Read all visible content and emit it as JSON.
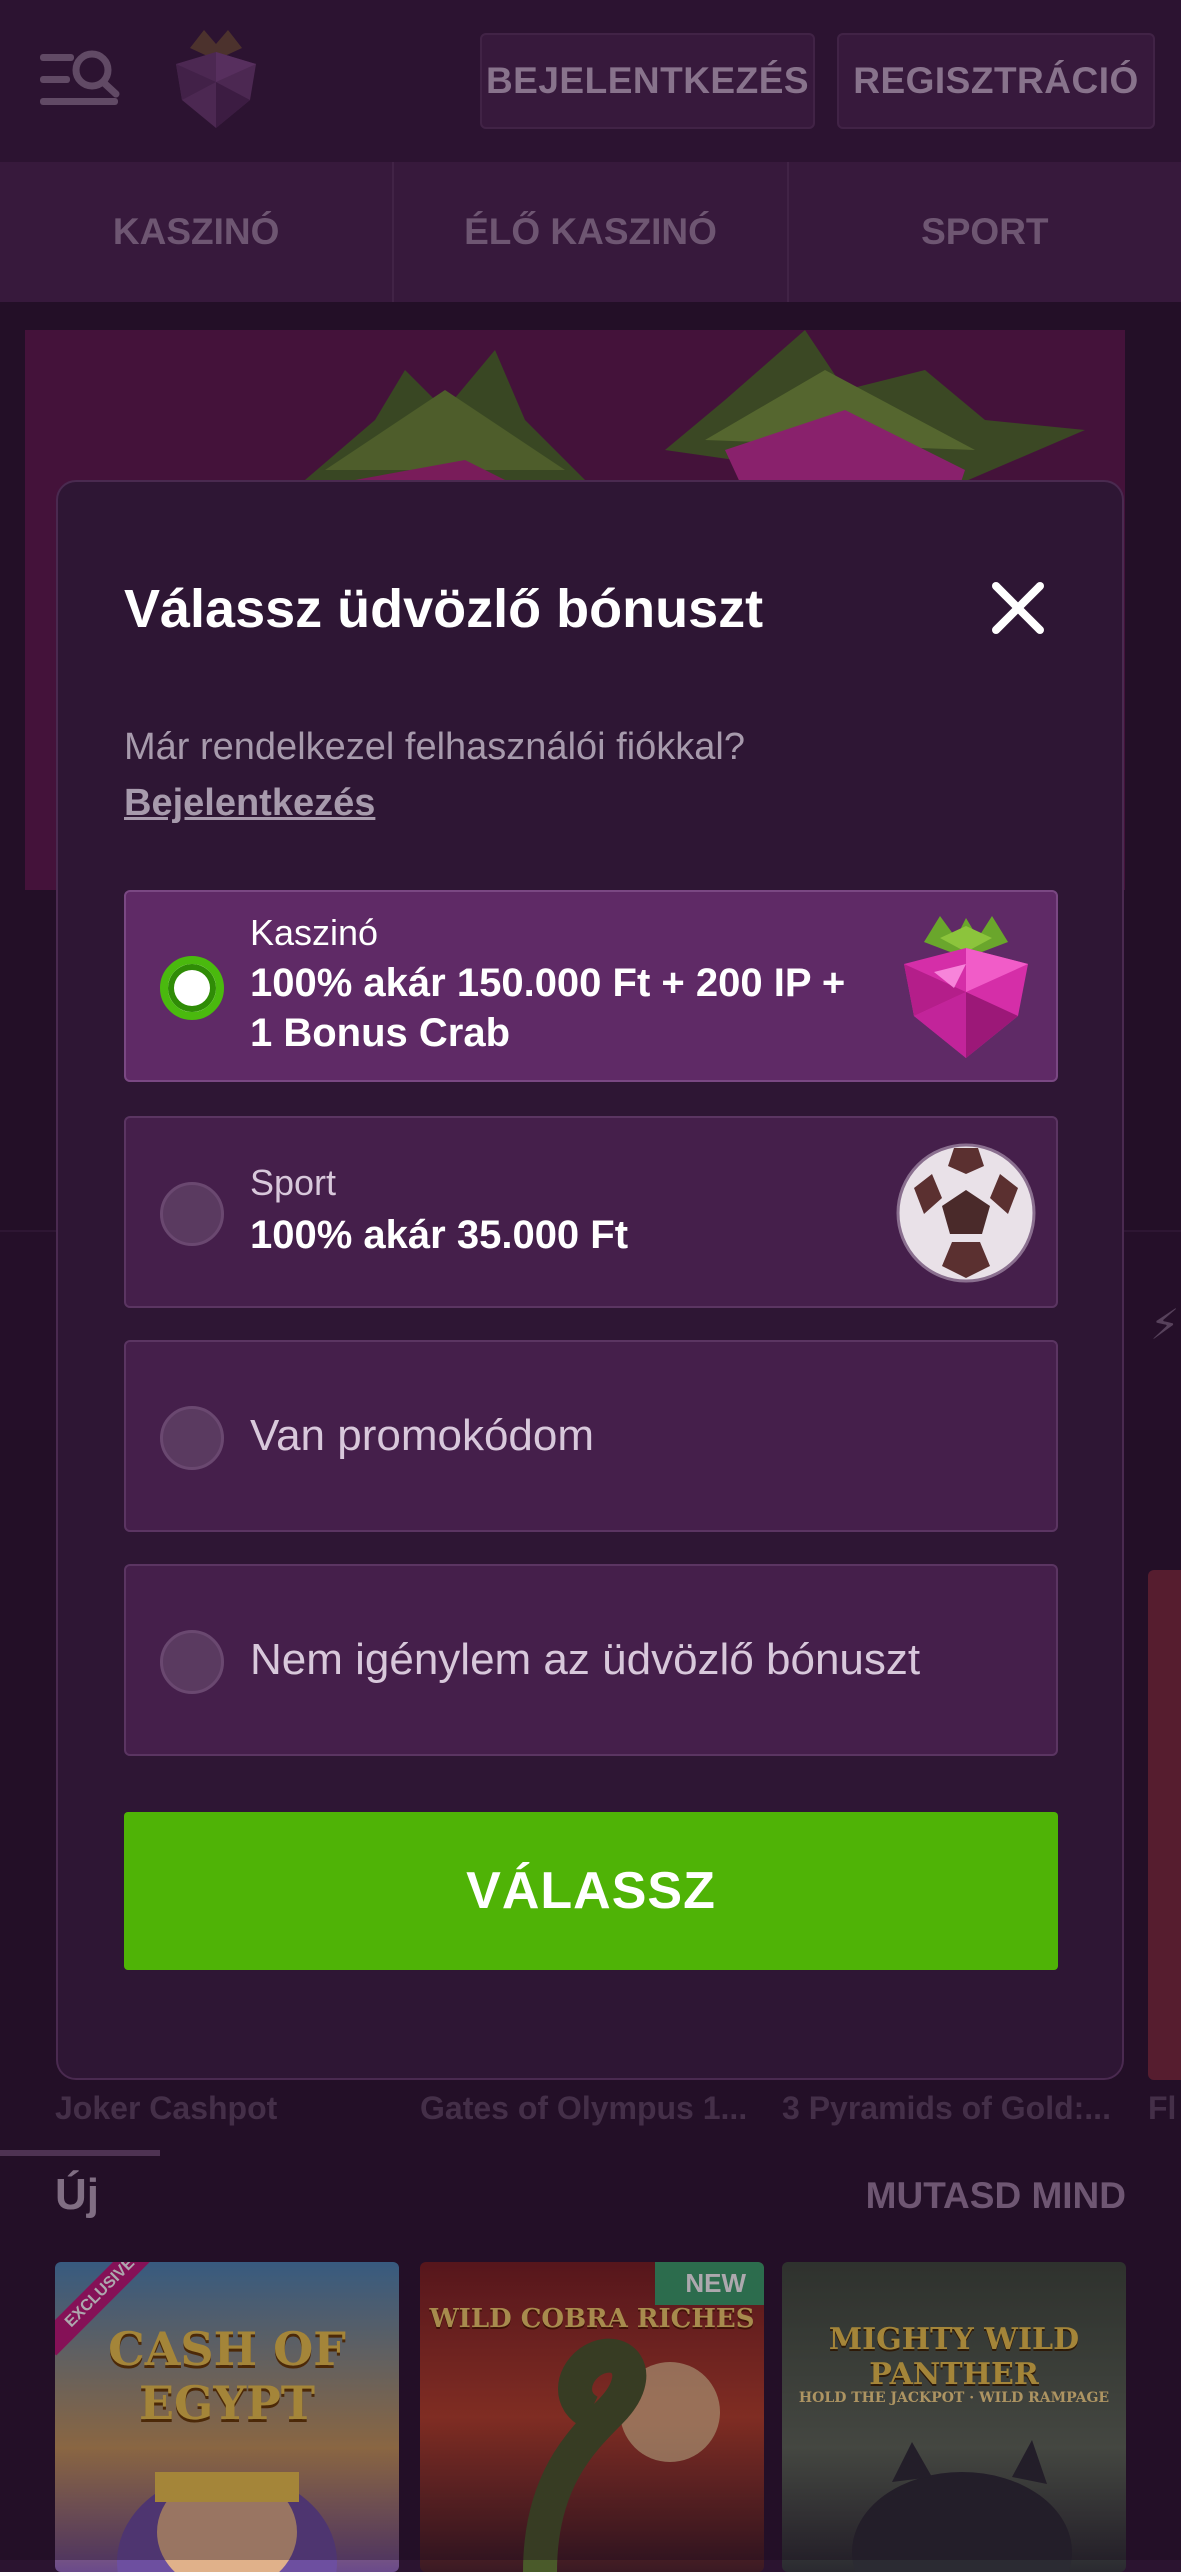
{
  "header": {
    "login_label": "BEJELENTKEZÉS",
    "register_label": "REGISZTRÁCIÓ"
  },
  "nav": {
    "tabs": [
      "KASZINÓ",
      "ÉLŐ KASZINÓ",
      "SPORT"
    ]
  },
  "games_row": {
    "names": [
      "Joker Cashpot",
      "Gates of Olympus 1...",
      "3 Pyramids of Gold:...",
      "Fl"
    ]
  },
  "new_section": {
    "title": "Új",
    "show_all": "MUTASD MIND",
    "tiles": [
      {
        "name": "CASH OF EGYPT",
        "badge": "EXCLUSIVE"
      },
      {
        "name": "WILD COBRA RICHES",
        "badge": "NEW"
      },
      {
        "name": "MIGHTY WILD PANTHER",
        "subtitle": "HOLD THE JACKPOT · WILD RAMPAGE"
      }
    ]
  },
  "modal": {
    "title": "Válassz üdvözlő bónuszt",
    "login_hint": "Már rendelkezel felhasználói fiókkal?",
    "login_link": "Bejelentkezés",
    "options": [
      {
        "label": "Kaszinó",
        "value": "100% akár 150.000 Ft + 200 IP + 1 Bonus Crab",
        "selected": true,
        "icon": "raspberry-icon"
      },
      {
        "label": "Sport",
        "value": "100% akár 35.000 Ft",
        "selected": false,
        "icon": "football-icon"
      },
      {
        "label": "Van promokódom",
        "selected": false
      },
      {
        "label": "Nem igénylem az üdvözlő bónuszt",
        "selected": false
      }
    ],
    "submit_label": "VÁLASSZ"
  },
  "colors": {
    "accent_green": "#4fb306",
    "background": "#2b1430",
    "modal_bg": "#2e1634",
    "option_selected_bg": "#5f2a66"
  }
}
